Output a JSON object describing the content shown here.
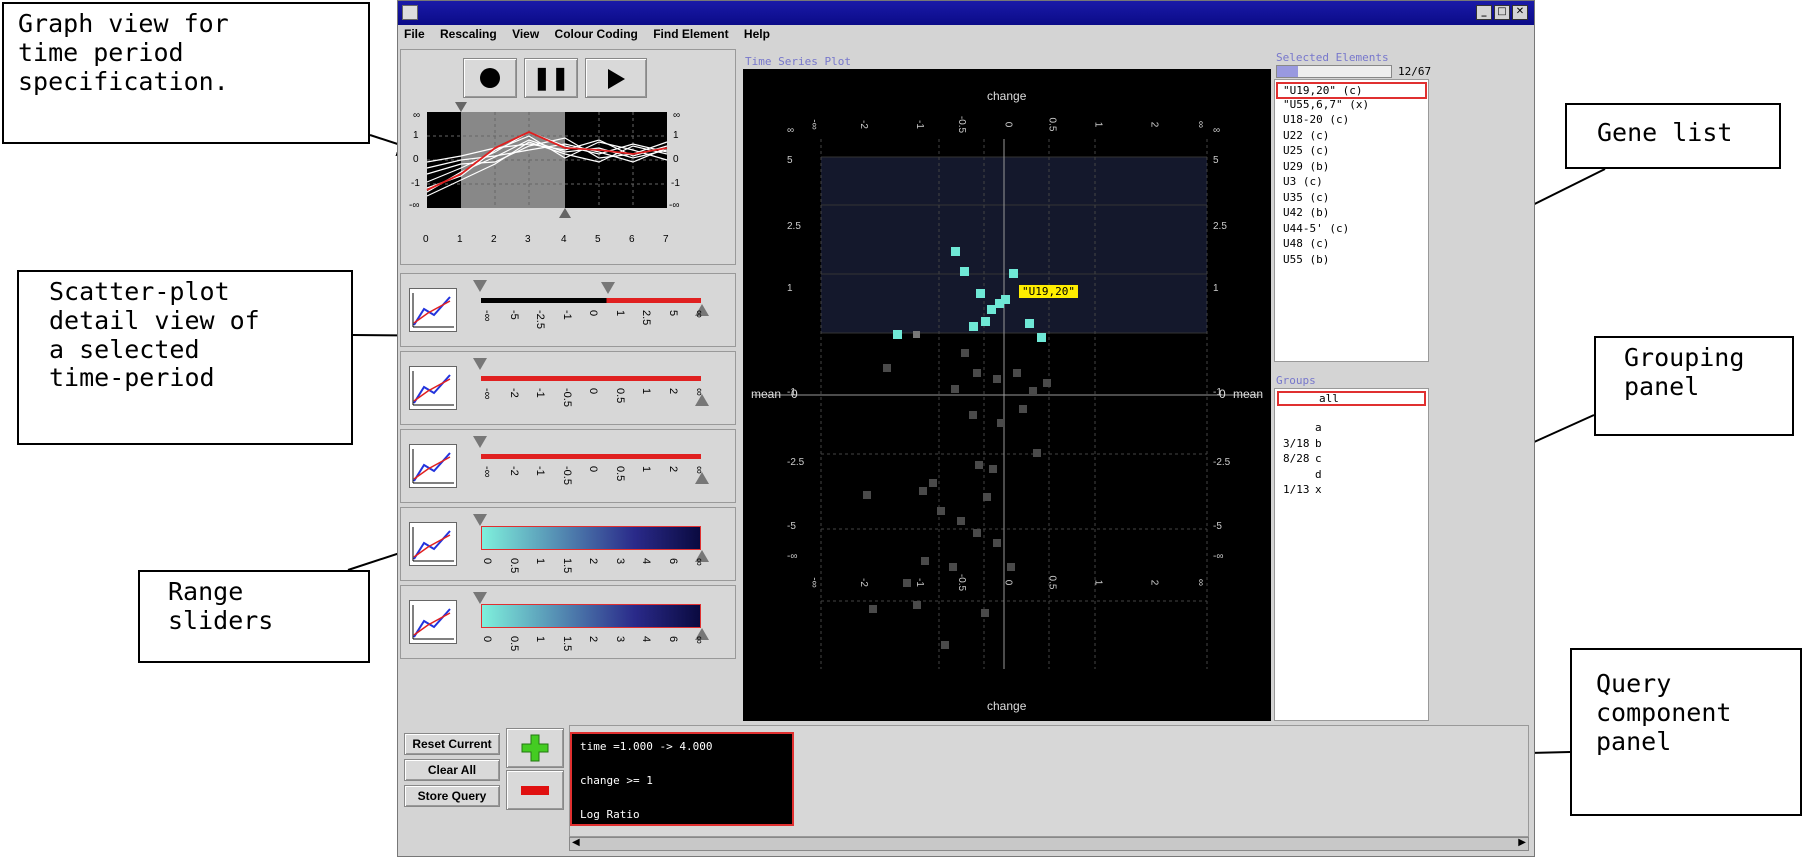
{
  "window": {
    "menu": [
      "File",
      "Rescaling",
      "View",
      "Colour Coding",
      "Find Element",
      "Help"
    ]
  },
  "callouts": {
    "graph_view": "Graph view for\ntime period\nspecification.",
    "scatter": "Scatter-plot\ndetail view of\na selected\ntime-period",
    "range": "Range\nsliders",
    "gene_list": "Gene list",
    "grouping": "Grouping\npanel",
    "query": "Query\ncomponent\npanel"
  },
  "timeline": {
    "y_ticks_left": [
      "∞",
      "1",
      "0",
      "-1",
      "-∞"
    ],
    "y_ticks_right": [
      "∞",
      "1",
      "0",
      "-1",
      "-∞"
    ],
    "x_ticks": [
      "0",
      "1",
      "2",
      "3",
      "4",
      "5",
      "6",
      "7"
    ]
  },
  "sliders": [
    {
      "ticks": [
        "-∞",
        "-5",
        "-2.5",
        "-1",
        "0",
        "1",
        "2.5",
        "5",
        "∞"
      ],
      "fill": "black-red"
    },
    {
      "ticks": [
        "-∞",
        "-2",
        "-1",
        "-0.5",
        "0",
        "0.5",
        "1",
        "2",
        "∞"
      ],
      "fill": "red"
    },
    {
      "ticks": [
        "-∞",
        "-2",
        "-1",
        "-0.5",
        "0",
        "0.5",
        "1",
        "2",
        "∞"
      ],
      "fill": "red"
    },
    {
      "ticks": [
        "0",
        "0.5",
        "1",
        "1.5",
        "2",
        "3",
        "4",
        "6",
        "∞"
      ],
      "fill": "gradient"
    },
    {
      "ticks": [
        "0",
        "0.5",
        "1",
        "1.5",
        "2",
        "3",
        "4",
        "6",
        "∞"
      ],
      "fill": "gradient"
    }
  ],
  "buttons": {
    "reset": "Reset Current",
    "clear": "Clear All",
    "store": "Store Query"
  },
  "plot": {
    "title": "Time Series Plot",
    "top_label": "change",
    "bottom_label": "change",
    "left_label": "mean",
    "right_label": "mean",
    "x_ticks": [
      "-∞",
      "-2",
      "-1",
      "-0.5",
      "0",
      "0.5",
      "1",
      "2",
      "∞"
    ],
    "y_ticks": [
      "∞",
      "5",
      "2.5",
      "1",
      "0",
      "-1",
      "-2.5",
      "-5",
      "-∞"
    ],
    "highlight_label": "\"U19,20\""
  },
  "selected": {
    "title": "Selected Elements",
    "count": "12/67",
    "progress": 0.18,
    "items": [
      "\"U19,20\" (c)",
      "\"U55,6,7\" (x)",
      "U18-20 (c)",
      "U22 (c)",
      "U25 (c)",
      "U29 (b)",
      "U3 (c)",
      "U35 (c)",
      "U42 (b)",
      "U44-5' (c)",
      "U48 (c)",
      "U55 (b)"
    ]
  },
  "groups": {
    "title": "Groups",
    "all": "all",
    "rows": [
      {
        "count": "",
        "name": "a"
      },
      {
        "count": "3/18",
        "name": "b"
      },
      {
        "count": "8/28",
        "name": "c"
      },
      {
        "count": "",
        "name": "d"
      },
      {
        "count": "1/13",
        "name": "x"
      }
    ]
  },
  "query": {
    "line1": "time =1.000 -> 4.000",
    "line2": "change >= 1",
    "line3": "Log Ratio"
  }
}
